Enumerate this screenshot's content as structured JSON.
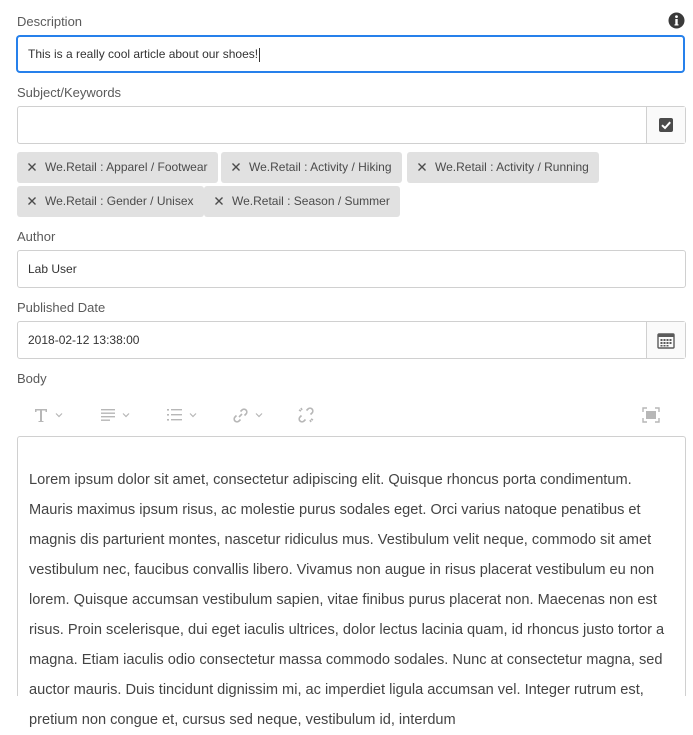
{
  "description": {
    "label": "Description",
    "value": "This is a really cool article about our shoes!"
  },
  "subject": {
    "label": "Subject/Keywords",
    "value": "",
    "tags": [
      "We.Retail : Apparel / Footwear",
      "We.Retail : Activity / Hiking",
      "We.Retail : Activity / Running",
      "We.Retail : Gender / Unisex",
      "We.Retail : Season / Summer"
    ]
  },
  "author": {
    "label": "Author",
    "value": "Lab User"
  },
  "published": {
    "label": "Published Date",
    "value": "2018-02-12 13:38:00"
  },
  "body": {
    "label": "Body",
    "toolbar": [
      "text-format-icon",
      "paragraph-align-icon",
      "list-icon",
      "link-icon",
      "unlink-icon",
      "fullscreen-icon"
    ],
    "text": "Lorem ipsum dolor sit amet, consectetur adipiscing elit. Quisque rhoncus porta condimentum. Mauris maximus ipsum risus, ac molestie purus sodales eget. Orci varius natoque penatibus et magnis dis parturient montes, nascetur ridiculus mus. Vestibulum velit neque, commodo sit amet vestibulum nec, faucibus convallis libero. Vivamus non augue in risus placerat vestibulum eu non lorem. Quisque accumsan vestibulum sapien, vitae finibus purus placerat non. Maecenas non est risus. Proin scelerisque, dui eget iaculis ultrices, dolor lectus lacinia quam, id rhoncus justo tortor a magna. Etiam iaculis odio consectetur massa commodo sodales. Nunc at consectetur magna, sed auctor mauris. Duis tincidunt dignissim mi, ac imperdiet ligula accumsan vel. Integer rutrum est, pretium non congue et, cursus sed neque, vestibulum id, interdum"
  },
  "colors": {
    "focus": "#2680eb",
    "tag_bg": "#e1e1e1",
    "border": "#d0d0d0"
  }
}
